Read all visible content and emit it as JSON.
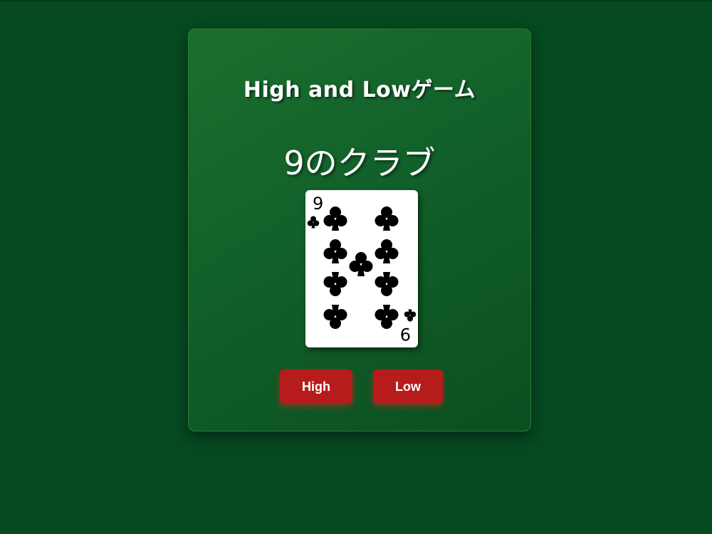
{
  "game": {
    "title": "High and Lowゲーム",
    "current_card_label": "9のクラブ",
    "card": {
      "rank": "9",
      "suit": "clubs",
      "suit_symbol": "♣",
      "pip_count": 9,
      "suit_color": "#000000"
    }
  },
  "controls": {
    "high_label": "High",
    "low_label": "Low"
  },
  "colors": {
    "background": "#054a21",
    "panel": "#12602a",
    "button": "#b71c1c",
    "text": "#ffffff"
  }
}
